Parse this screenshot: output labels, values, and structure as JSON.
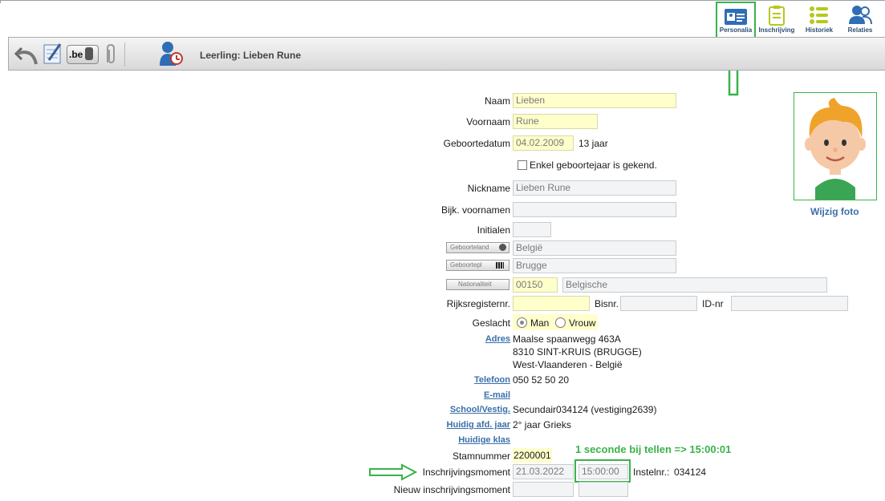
{
  "nav": {
    "personalia": "Personalia",
    "inschrijving": "Inschrijving",
    "historiek": "Historiek",
    "relaties": "Relaties"
  },
  "toolbar": {
    "title": "Leerling: Lieben Rune",
    "be_label": ".be"
  },
  "form": {
    "naam_label": "Naam",
    "naam": "Lieben",
    "voornaam_label": "Voornaam",
    "voornaam": "Rune",
    "geboortedatum_label": "Geboortedatum",
    "geboortedatum": "04.02.2009",
    "leeftijd": "13 jaar",
    "enkel_label": "Enkel geboortejaar is gekend.",
    "nickname_label": "Nickname",
    "nickname": "Lieben Rune",
    "bijk_label": "Bijk.  voornamen",
    "initialen_label": "Initialen",
    "geboorteland_btn": "Geboorteland",
    "geboorteland": "België",
    "geboorteplaats_btn": "Geboortepl",
    "geboorteplaats": "Brugge",
    "nationaliteit_btn": "Nationaliteit",
    "nationaliteit_code": "00150",
    "nationaliteit": "Belgische",
    "rijksregister_label": "Rijksregisternr.",
    "bisnr_label": "Bisnr.",
    "idnr_label": "ID-nr",
    "geslacht_label": "Geslacht",
    "man_label": "Man",
    "vrouw_label": "Vrouw",
    "adres_label": "Adres",
    "adres_1": "Maalse spaanwegg  463A",
    "adres_2": "8310  SINT-KRUIS (BRUGGE)",
    "adres_3": "West-Vlaanderen - België",
    "telefoon_label": "Telefoon",
    "telefoon": "050 52 50 20",
    "email_label": "E-mail",
    "school_label": "School/Vestig.",
    "school": "Secundair034124 (vestiging2639)",
    "afd_label": "Huidig afd. jaar",
    "afd": "2° jaar Grieks",
    "klas_label": "Huidige klas",
    "stamnummer_label": "Stamnummer",
    "stamnummer": "2200001",
    "inschrijving_label": "Inschrijvingsmoment",
    "inschrijving_datum": "21.03.2022",
    "inschrijving_tijd": "15:00:00",
    "instelnr_label": "Instelnr.:",
    "instelnr": "034124",
    "nieuw_label": "Nieuw inschrijvingsmoment"
  },
  "photo": {
    "wijzig_label": "Wijzig foto"
  },
  "annotation": {
    "note": "1 seconde bij tellen => 15:00:01"
  },
  "colors": {
    "accent_green": "#39b34a",
    "link_blue": "#3a6faa",
    "field_yellow": "#ffffcc"
  }
}
